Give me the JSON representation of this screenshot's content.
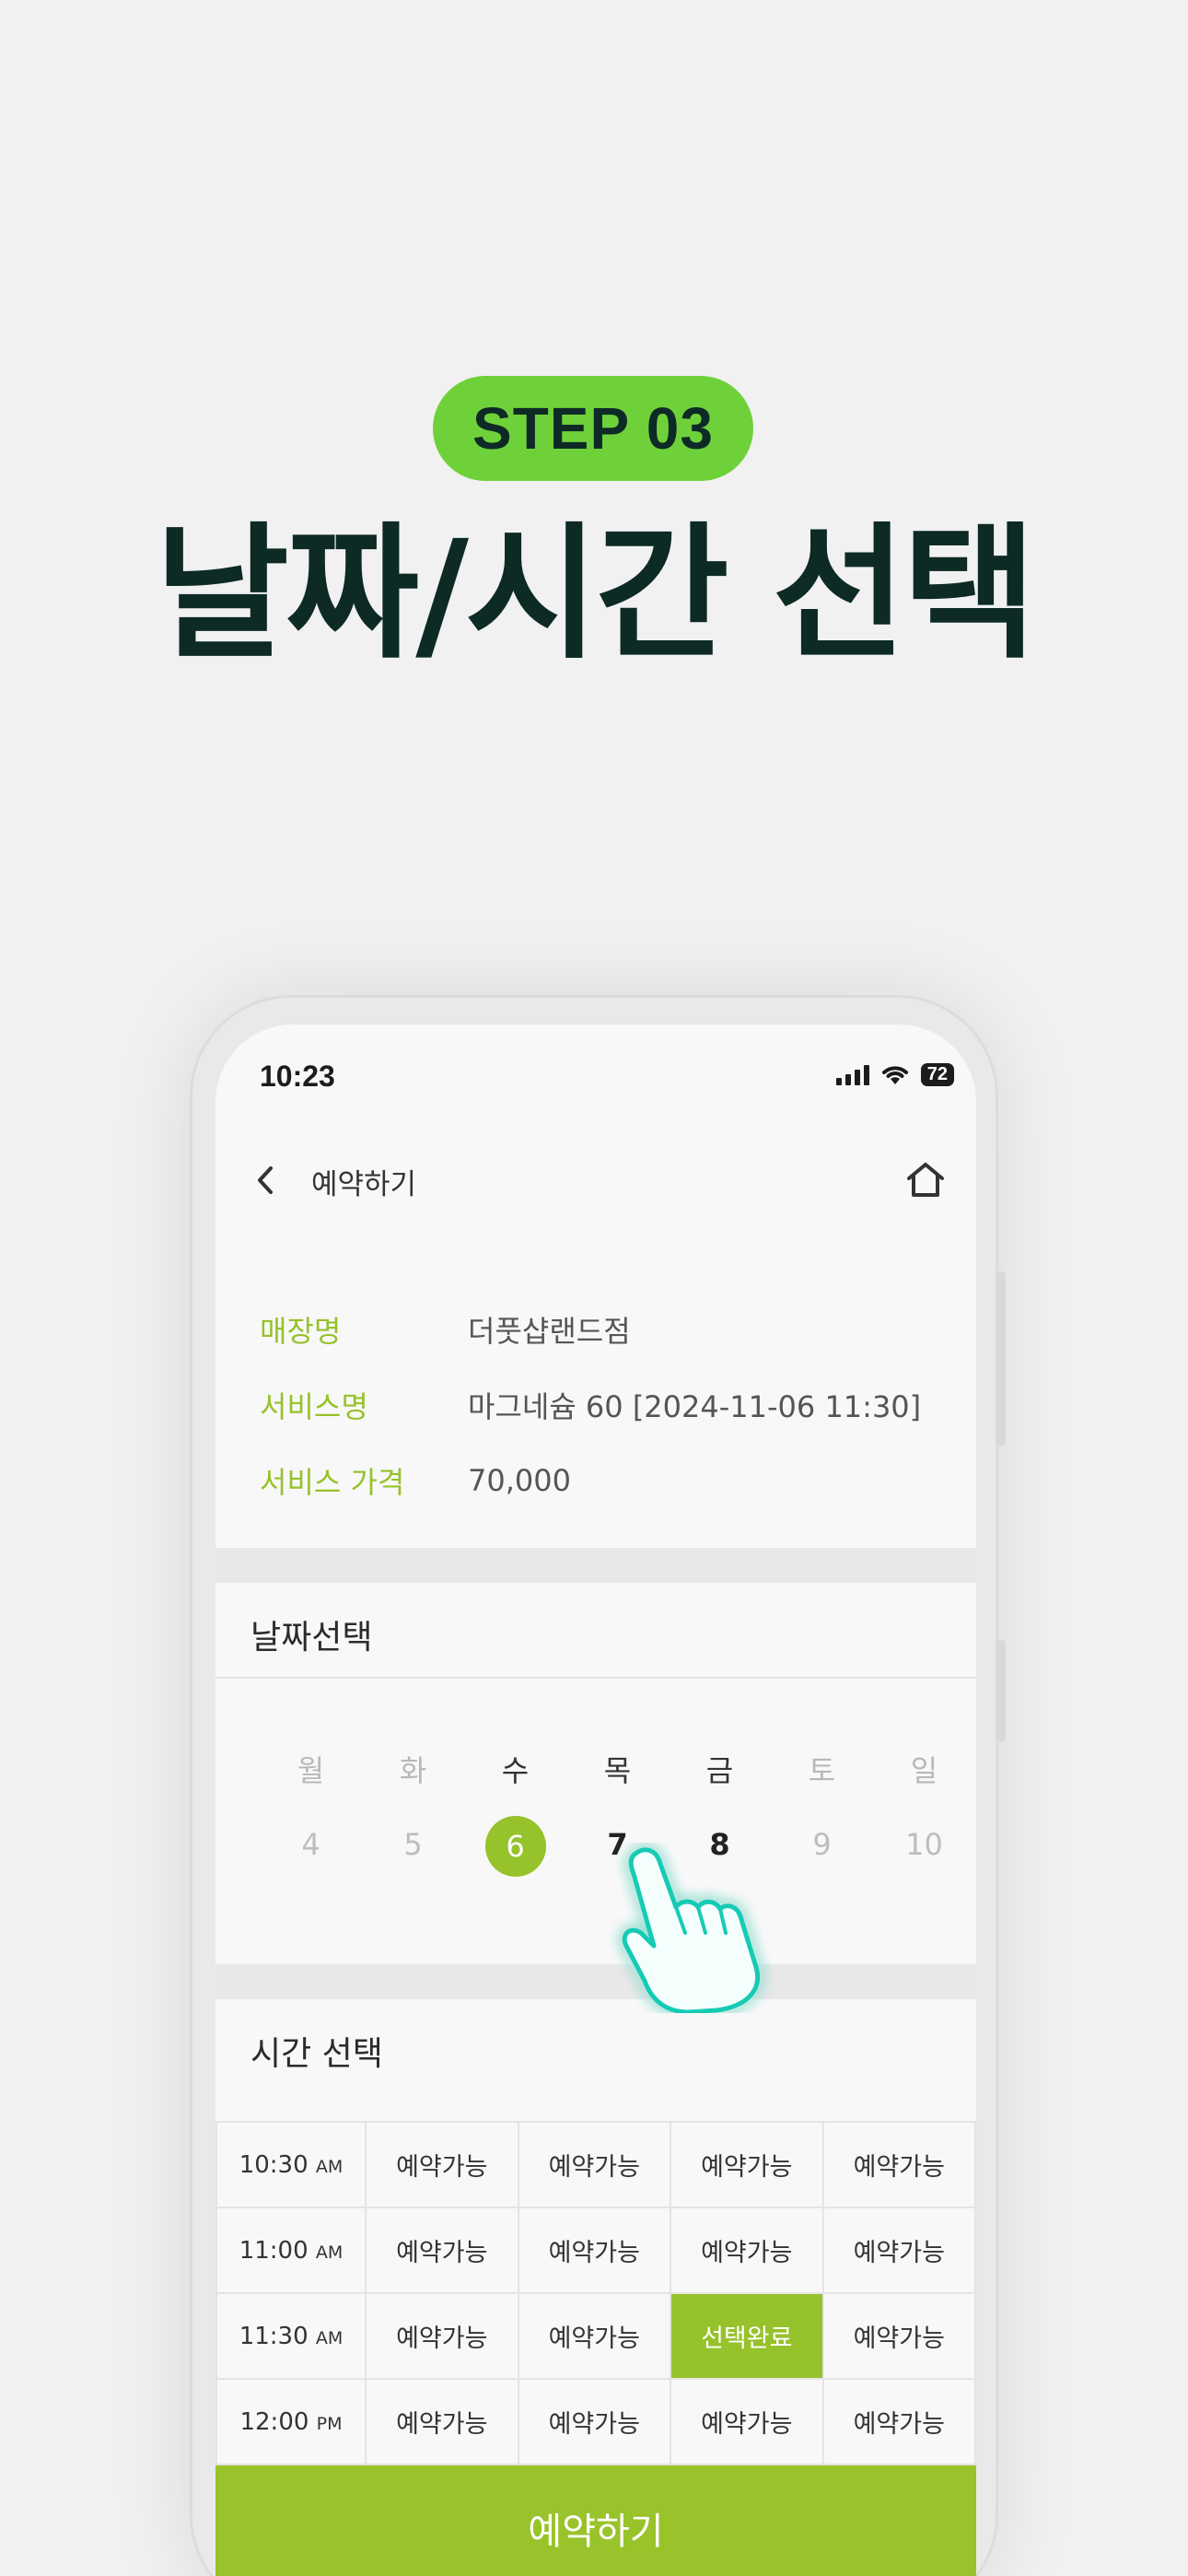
{
  "promo": {
    "step": "STEP 03",
    "headline": "날짜/시간 선택"
  },
  "status_bar": {
    "time": "10:23",
    "battery": "72"
  },
  "nav": {
    "title": "예약하기"
  },
  "info": [
    {
      "label": "매장명",
      "value": "더풋샵랜드점"
    },
    {
      "label": "서비스명",
      "value": "마그네슘 60 [2024-11-06 11:30]"
    },
    {
      "label": "서비스 가격",
      "value": "70,000"
    }
  ],
  "date_section": {
    "title": "날짜선택",
    "weekdays": [
      "월",
      "화",
      "수",
      "목",
      "금",
      "토",
      "일"
    ],
    "dates": [
      "4",
      "5",
      "6",
      "7",
      "8",
      "9",
      "10"
    ],
    "selected_date": "6"
  },
  "time_section": {
    "title": "시간 선택",
    "rows": [
      {
        "time": "10:30",
        "ampm": "AM",
        "slots": [
          "예약가능",
          "예약가능",
          "예약가능",
          "예약가능"
        ]
      },
      {
        "time": "11:00",
        "ampm": "AM",
        "slots": [
          "예약가능",
          "예약가능",
          "예약가능",
          "예약가능"
        ]
      },
      {
        "time": "11:30",
        "ampm": "AM",
        "slots": [
          "예약가능",
          "예약가능",
          "선택완료",
          "예약가능"
        ]
      },
      {
        "time": "12:00",
        "ampm": "PM",
        "slots": [
          "예약가능",
          "예약가능",
          "예약가능",
          "예약가능"
        ]
      }
    ]
  },
  "book_button": {
    "label": "예약하기"
  },
  "colors": {
    "accent": "#96c22b",
    "badge": "#6fd13a",
    "headline": "#0d2a25",
    "glow": "#2fe0c8"
  },
  "icons": {
    "back": "chevron-left-icon",
    "home": "home-icon",
    "hand": "pointing-hand-icon",
    "wifi": "wifi-icon",
    "signal": "signal-icon",
    "battery": "battery-icon"
  }
}
